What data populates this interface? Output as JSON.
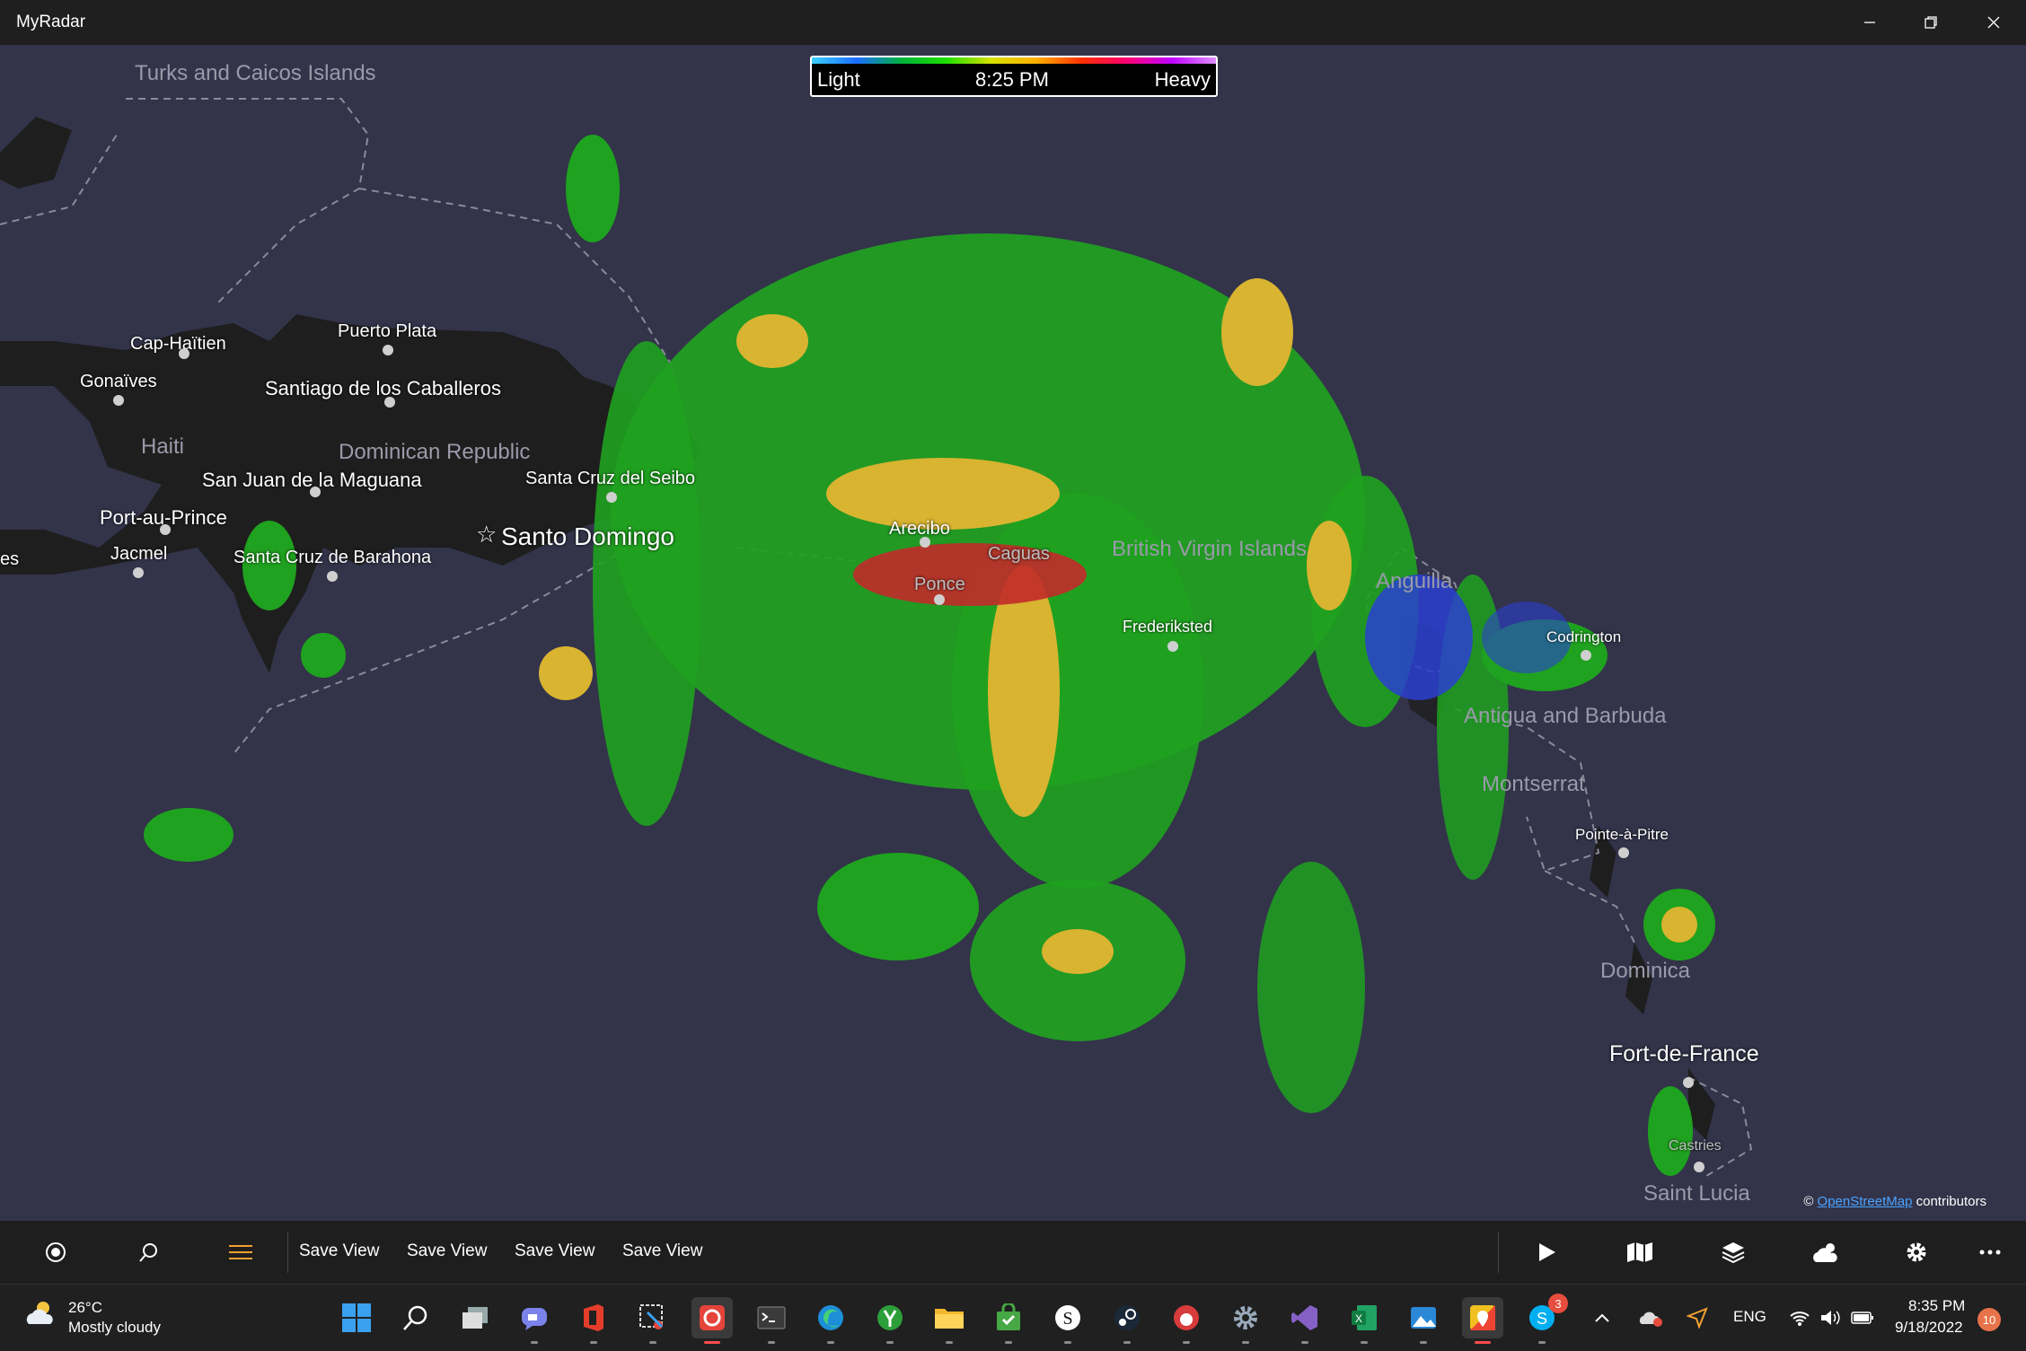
{
  "window": {
    "title": "MyRadar"
  },
  "legend": {
    "light": "Light",
    "time": "8:25 PM",
    "heavy": "Heavy"
  },
  "map_labels": {
    "turks_caicos": "Turks and Caicos Islands",
    "cap_haitien": "Cap-Haïtien",
    "gonaives": "Gonaïves",
    "puerto_plata": "Puerto Plata",
    "santiago": "Santiago de los Caballeros",
    "haiti": "Haiti",
    "dominican_republic": "Dominican Republic",
    "san_juan_maguana": "San Juan de la Maguana",
    "santa_cruz_seibo": "Santa Cruz del Seibo",
    "port_au_prince": "Port-au-Prince",
    "santo_domingo": "Santo Domingo",
    "jacmel": "Jacmel",
    "santa_cruz_barahona": "Santa Cruz de Barahona",
    "es": "es",
    "arecibo": "Arecibo",
    "caguas": "Caguas",
    "ponce": "Ponce",
    "bvi": "British Virgin Islands",
    "frederiksted": "Frederiksted",
    "anguilla": "Anguilla",
    "codrington": "Codrington",
    "antigua": "Antigua and Barbuda",
    "montserrat": "Montserrat",
    "pointe_a_pitre": "Pointe-à-Pitre",
    "dominica": "Dominica",
    "fort_de_france": "Fort-de-France",
    "castries": "Castries",
    "saint_lucia": "Saint Lucia"
  },
  "attribution": {
    "symbol": "©",
    "link": "OpenStreetMap",
    "rest": "contributors"
  },
  "commandbar": {
    "save_views": [
      "Save View",
      "Save View",
      "Save View",
      "Save View"
    ]
  },
  "taskbar": {
    "weather_temp": "26°C",
    "weather_condition": "Mostly cloudy",
    "language": "ENG",
    "time": "8:35 PM",
    "date": "9/18/2022",
    "notification_count": "10",
    "skype_badge": "3"
  },
  "colors": {
    "map_bg": "#33334a",
    "land": "#1e1e1e",
    "radar_green": "#1fa21f",
    "radar_yellow": "#d8b431",
    "radar_red": "#c22a2a",
    "radar_blue": "#2a3fd0"
  }
}
